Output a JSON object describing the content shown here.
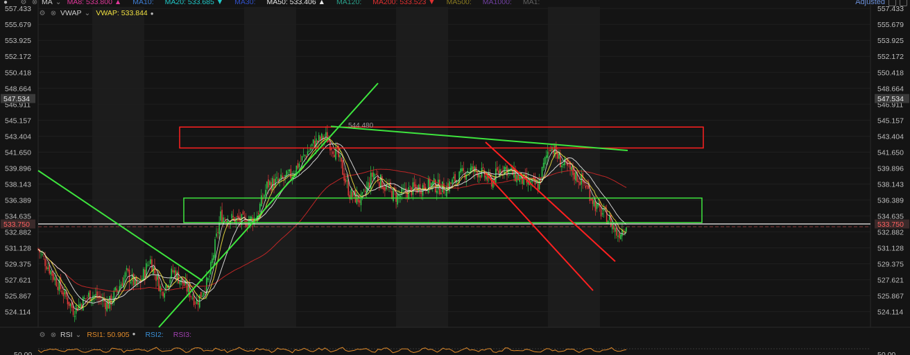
{
  "indicators": {
    "ma": {
      "label": "MA",
      "items": [
        {
          "name": "MA8:",
          "value": "533.800",
          "color": "#e0389a",
          "arrow": "▲"
        },
        {
          "name": "MA10:",
          "value": "",
          "color": "#3f7fd6",
          "arrow": ""
        },
        {
          "name": "MA20:",
          "value": "533.685",
          "color": "#20c8c8",
          "arrow": "▼"
        },
        {
          "name": "MA30:",
          "value": "",
          "color": "#3050c8",
          "arrow": ""
        },
        {
          "name": "MA50:",
          "value": "533.406",
          "color": "#e8e8e8",
          "arrow": "▲"
        },
        {
          "name": "MA120:",
          "value": "",
          "color": "#2aa08a",
          "arrow": ""
        },
        {
          "name": "MA200:",
          "value": "533.523",
          "color": "#e03030",
          "arrow": "▼"
        },
        {
          "name": "MA500:",
          "value": "",
          "color": "#8a7a20",
          "arrow": ""
        },
        {
          "name": "MA1000:",
          "value": "",
          "color": "#7040a0",
          "arrow": ""
        },
        {
          "name": "MA1:",
          "value": "",
          "color": "#606060",
          "arrow": ""
        }
      ]
    },
    "vwap": {
      "label": "VWAP",
      "name": "VWAP:",
      "value": "533.844",
      "color": "#f0e040"
    },
    "rsi": {
      "label": "RSI",
      "items": [
        {
          "name": "RSI1:",
          "value": "50.905",
          "color": "#e08a2a"
        },
        {
          "name": "RSI2:",
          "value": "",
          "color": "#3a8fd6"
        },
        {
          "name": "RSI3:",
          "value": "",
          "color": "#a040b0"
        }
      ]
    }
  },
  "header": {
    "adjusted_label": "Adjusted"
  },
  "chart_data": {
    "type": "candlestick",
    "y_axis": {
      "ticks": [
        "557.433",
        "555.679",
        "553.925",
        "552.172",
        "550.418",
        "548.664",
        "546.911",
        "545.157",
        "543.404",
        "541.650",
        "539.896",
        "538.143",
        "536.389",
        "534.635",
        "532.882",
        "531.128",
        "529.375",
        "527.621",
        "525.867",
        "524.114"
      ],
      "range": [
        522.4,
        557.6
      ],
      "current_price_label": "547.534",
      "last_price_label": "533.750"
    },
    "rsi_axis": {
      "tick": "50.00"
    },
    "annotations": {
      "peak_label": "544.480",
      "peak_value": 544.48
    },
    "colors": {
      "up": "#e03a3a",
      "down": "#2ec84a",
      "trendline_green": "#3ee63e",
      "trendline_red": "#ff2020",
      "rsi": "#e08a2a"
    },
    "resistance_zone": [
      542.1,
      544.4
    ],
    "support_zone": [
      533.9,
      536.6
    ],
    "horizontal_line": 533.75,
    "price_path": [
      [
        0,
        531.0
      ],
      [
        0.03,
        527.6
      ],
      [
        0.06,
        524.3
      ],
      [
        0.09,
        526.1
      ],
      [
        0.12,
        524.9
      ],
      [
        0.15,
        528.3
      ],
      [
        0.17,
        526.8
      ],
      [
        0.19,
        529.9
      ],
      [
        0.21,
        526.3
      ],
      [
        0.23,
        528.6
      ],
      [
        0.25,
        526.9
      ],
      [
        0.27,
        525.2
      ],
      [
        0.29,
        527.6
      ],
      [
        0.31,
        534.6
      ],
      [
        0.33,
        534.3
      ],
      [
        0.35,
        534.0
      ],
      [
        0.37,
        534.4
      ],
      [
        0.39,
        538.1
      ],
      [
        0.41,
        538.4
      ],
      [
        0.43,
        539.1
      ],
      [
        0.45,
        541.0
      ],
      [
        0.47,
        542.7
      ],
      [
        0.49,
        543.3
      ],
      [
        0.51,
        541.2
      ],
      [
        0.53,
        537.0
      ],
      [
        0.55,
        536.3
      ],
      [
        0.57,
        539.4
      ],
      [
        0.59,
        537.8
      ],
      [
        0.61,
        536.7
      ],
      [
        0.63,
        537.4
      ],
      [
        0.65,
        537.8
      ],
      [
        0.67,
        538.1
      ],
      [
        0.69,
        537.6
      ],
      [
        0.71,
        538.6
      ],
      [
        0.73,
        539.7
      ],
      [
        0.75,
        539.5
      ],
      [
        0.77,
        538.4
      ],
      [
        0.79,
        540.1
      ],
      [
        0.81,
        539.1
      ],
      [
        0.83,
        538.3
      ],
      [
        0.85,
        537.9
      ],
      [
        0.87,
        542.6
      ],
      [
        0.89,
        540.4
      ],
      [
        0.91,
        539.3
      ],
      [
        0.93,
        538.1
      ],
      [
        0.95,
        535.5
      ],
      [
        0.97,
        534.3
      ],
      [
        0.985,
        532.6
      ],
      [
        1.0,
        533.75
      ]
    ]
  }
}
